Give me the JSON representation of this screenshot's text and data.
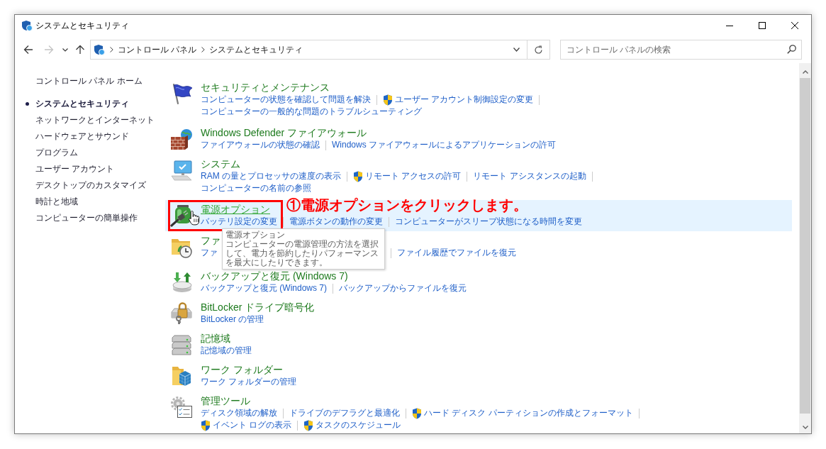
{
  "window": {
    "title": "システムとセキュリティ"
  },
  "navigation": [
    {
      "kind": "back",
      "disabled": false
    },
    {
      "kind": "forward",
      "disabled": true
    },
    {
      "kind": "recent",
      "disabled": false
    },
    {
      "kind": "up",
      "disabled": false
    }
  ],
  "address_bar": {
    "breadcrumbs": [
      "コントロール パネル",
      "システムとセキュリティ"
    ]
  },
  "search": {
    "placeholder": "コントロール パネルの検索"
  },
  "sidebar": {
    "home": "コントロール パネル ホーム",
    "items": [
      {
        "label": "システムとセキュリティ",
        "selected": true
      },
      {
        "label": "ネットワークとインターネット",
        "selected": false
      },
      {
        "label": "ハードウェアとサウンド",
        "selected": false
      },
      {
        "label": "プログラム",
        "selected": false
      },
      {
        "label": "ユーザー アカウント",
        "selected": false
      },
      {
        "label": "デスクトップのカスタマイズ",
        "selected": false
      },
      {
        "label": "時計と地域",
        "selected": false
      },
      {
        "label": "コンピューターの簡単操作",
        "selected": false
      }
    ]
  },
  "sections": [
    {
      "title": "セキュリティとメンテナンス",
      "hovered": false,
      "link_rows": [
        [
          {
            "text": "コンピューターの状態を確認して問題を解決",
            "shield": false
          },
          {
            "text": "ユーザー アカウント制御設定の変更",
            "shield": true
          }
        ],
        [
          {
            "text": "コンピューターの一般的な問題のトラブルシューティング",
            "shield": false
          }
        ]
      ]
    },
    {
      "title": "Windows Defender ファイアウォール",
      "hovered": false,
      "link_rows": [
        [
          {
            "text": "ファイアウォールの状態の確認",
            "shield": false
          },
          {
            "text": "Windows ファイアウォールによるアプリケーションの許可",
            "shield": false
          }
        ]
      ]
    },
    {
      "title": "システム",
      "hovered": false,
      "link_rows": [
        [
          {
            "text": "RAM の量とプロセッサの速度の表示",
            "shield": false
          },
          {
            "text": "リモート アクセスの許可",
            "shield": true
          },
          {
            "text": "リモート アシスタンスの起動",
            "shield": false
          }
        ],
        [
          {
            "text": "コンピューターの名前の参照",
            "shield": false
          }
        ]
      ]
    },
    {
      "title": "電源オプション",
      "hovered": true,
      "link_rows": [
        [
          {
            "text": "バッテリ設定の変更",
            "shield": false
          },
          {
            "text": "電源ボタンの動作の変更",
            "shield": false
          },
          {
            "text": "コンピューターがスリープ状態になる時間を変更",
            "shield": false
          }
        ]
      ],
      "annotation": {
        "text": "①電源オプションをクリックします。"
      },
      "tooltip": {
        "title": "電源オプション",
        "text": "コンピューターの電源管理の方法を選択して、電力を節約したりパフォーマンスを最大にしたりできます。"
      }
    },
    {
      "title": "ファ",
      "hovered": false,
      "link_rows": [
        [
          {
            "text": "ファ",
            "shield": false
          },
          {
            "text": "ファイル履歴でファイルを復元",
            "shield": false
          }
        ]
      ]
    },
    {
      "title": "バックアップと復元 (Windows 7)",
      "hovered": false,
      "link_rows": [
        [
          {
            "text": "バックアップと復元 (Windows 7)",
            "shield": false
          },
          {
            "text": "バックアップからファイルを復元",
            "shield": false
          }
        ]
      ]
    },
    {
      "title": "BitLocker ドライブ暗号化",
      "hovered": false,
      "link_rows": [
        [
          {
            "text": "BitLocker の管理",
            "shield": false
          }
        ]
      ]
    },
    {
      "title": "記憶域",
      "hovered": false,
      "link_rows": [
        [
          {
            "text": "記憶域の管理",
            "shield": false
          }
        ]
      ]
    },
    {
      "title": "ワーク フォルダー",
      "hovered": false,
      "link_rows": [
        [
          {
            "text": "ワーク フォルダーの管理",
            "shield": false
          }
        ]
      ]
    },
    {
      "title": "管理ツール",
      "hovered": false,
      "link_rows": [
        [
          {
            "text": "ディスク領域の解放",
            "shield": false
          },
          {
            "text": "ドライブのデフラグと最適化",
            "shield": false
          },
          {
            "text": "ハード ディスク パーティションの作成とフォーマット",
            "shield": true
          }
        ],
        [
          {
            "text": "イベント ログの表示",
            "shield": true
          },
          {
            "text": "タスクのスケジュール",
            "shield": true
          }
        ]
      ]
    }
  ]
}
